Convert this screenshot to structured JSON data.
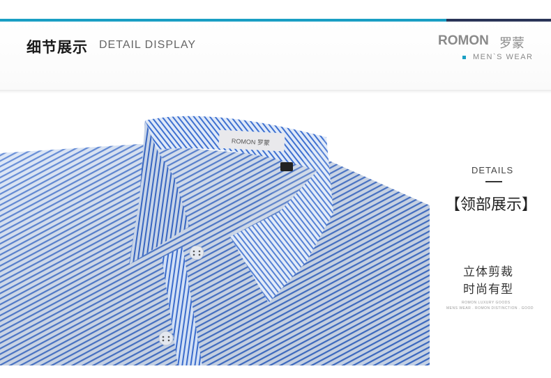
{
  "header": {
    "title_cn": "细节展示",
    "title_en": "DETAIL DISPLAY",
    "brand": "ROMON",
    "brand_cn": "罗蒙",
    "subbrand": "MEN`S  WEAR"
  },
  "photo": {
    "label_brand": "ROMON 罗蒙",
    "shirt_color": "#8fb2e6",
    "stripe_color": "#3d6fcf"
  },
  "side": {
    "details_en": "DETAILS",
    "details_cn": "【领部展示】",
    "desc_line1": "立体剪裁",
    "desc_line2": "时尚有型",
    "fine_line1": "ROMON LUXURY GOODS",
    "fine_line2": "MENS WEAR . ROMON DISTINCTION . GOOD"
  },
  "colors": {
    "accent": "#1a9fc4",
    "accent_dark": "#2a3558"
  }
}
